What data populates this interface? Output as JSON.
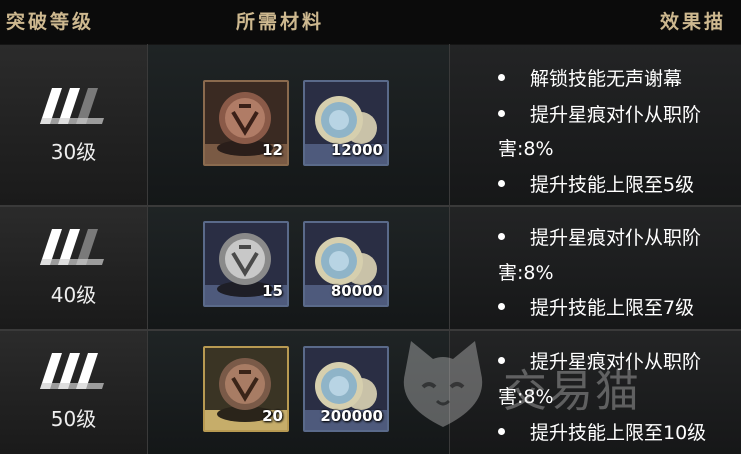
{
  "header": {
    "col1": "突破等级",
    "col2": "所需材料",
    "col3": "效果描"
  },
  "rows": [
    {
      "rank": "30级",
      "icon": "triple-slash-rank-icon",
      "materials": [
        {
          "icon": "bronze-emblem-icon",
          "qty": "12"
        },
        {
          "icon": "silver-coin-stack-icon",
          "qty": "12000"
        }
      ],
      "effects": {
        "l1": "解锁技能无声谢幕",
        "l2": "提升星痕对仆从职阶",
        "l3": "害:8%",
        "l4": "提升技能上限至5级"
      }
    },
    {
      "rank": "40级",
      "icon": "triple-slash-rank-icon",
      "materials": [
        {
          "icon": "silver-emblem-icon",
          "qty": "15"
        },
        {
          "icon": "silver-coin-stack-icon",
          "qty": "80000"
        }
      ],
      "effects": {
        "l1": "提升星痕对仆从职阶",
        "l2": "害:8%",
        "l3": "提升技能上限至7级"
      }
    },
    {
      "rank": "50级",
      "icon": "triple-slash-rank-icon",
      "materials": [
        {
          "icon": "gold-emblem-icon",
          "qty": "20"
        },
        {
          "icon": "silver-coin-stack-icon",
          "qty": "200000"
        }
      ],
      "effects": {
        "l1": "提升星痕对仆从职阶",
        "l2": "害:8%",
        "l3": "提升技能上限至10级"
      }
    }
  ],
  "watermark": {
    "text": "交易猫",
    "icon": "cat-face-icon"
  }
}
